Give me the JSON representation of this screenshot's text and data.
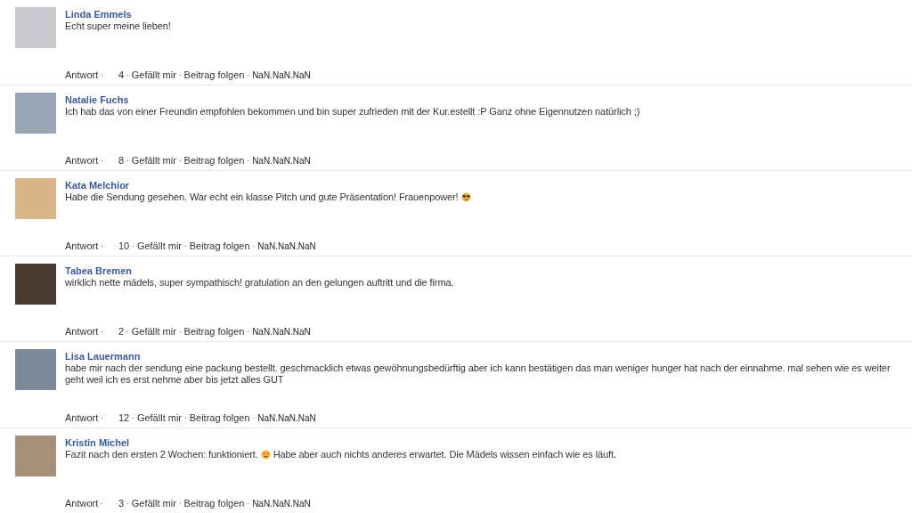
{
  "separator": "·",
  "comments": [
    {
      "author": "Linda Emmels",
      "parts": [
        {
          "kind": "text",
          "text": "Echt super meine lieben!"
        }
      ],
      "reply": "Antwort",
      "likes": "4",
      "like": "Gefällt mir",
      "follow": "Beitrag folgen",
      "date": "NaN.NaN.NaN"
    },
    {
      "author": "Natalie Fuchs",
      "parts": [
        {
          "kind": "text",
          "text": "Ich hab das von einer Freundin empfohlen bekommen und bin super zufrieden mit der Kur.estellt :P Ganz ohne Eigennutzen natürlich ;)"
        }
      ],
      "reply": "Antwort",
      "likes": "8",
      "like": "Gefällt mir",
      "follow": "Beitrag folgen",
      "date": "NaN.NaN.NaN"
    },
    {
      "author": "Kata Melchior",
      "parts": [
        {
          "kind": "text",
          "text": "Habe die Sendung gesehen. War echt ein klasse Pitch und gute Präsentation! Frauenpower!"
        },
        {
          "kind": "sunglasses"
        }
      ],
      "reply": "Antwort",
      "likes": "10",
      "like": "Gefällt mir",
      "follow": "Beitrag folgen",
      "date": "NaN.NaN.NaN"
    },
    {
      "author": "Tabea Bremen",
      "parts": [
        {
          "kind": "text",
          "text": "wirklich nette mädels, super sympathisch! gratulation an den gelungen auftritt und die firma."
        }
      ],
      "reply": "Antwort",
      "likes": "2",
      "like": "Gefällt mir",
      "follow": "Beitrag folgen",
      "date": "NaN.NaN.NaN"
    },
    {
      "author": "Lisa Lauermann",
      "parts": [
        {
          "kind": "text",
          "text": "habe mir nach der sendung eine packung bestellt. geschmacklich etwas gewöhnungsbedürftig aber ich kann bestätigen das man weniger hunger hat nach der einnahme. mal sehen wie es weiter geht weil ich es erst nehme aber bis jetzt alles GUT"
        }
      ],
      "reply": "Antwort",
      "likes": "12",
      "like": "Gefällt mir",
      "follow": "Beitrag folgen",
      "date": "NaN.NaN.NaN"
    },
    {
      "author": "Kristin Michel",
      "parts": [
        {
          "kind": "text",
          "text": "Fazit nach den ersten 2 Wochen: funktioniert."
        },
        {
          "kind": "heart-eyes"
        },
        {
          "kind": "text",
          "text": "Habe aber auch nichts anderes erwartet. Die Mädels wissen einfach wie es läuft."
        }
      ],
      "reply": "Antwort",
      "likes": "3",
      "like": "Gefällt mir",
      "follow": "Beitrag folgen",
      "date": "NaN.NaN.NaN"
    }
  ]
}
